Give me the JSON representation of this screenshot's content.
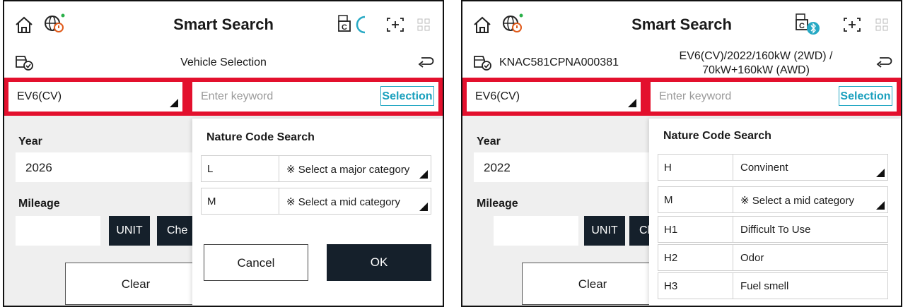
{
  "colors": {
    "accent_red": "#e3102d",
    "dark_button": "#15202b",
    "selection_blue": "#1aa0bd"
  },
  "panels": [
    {
      "title": "Smart Search",
      "subbar": {
        "title": "Vehicle Selection",
        "vin": "",
        "desc": ""
      },
      "model": "EV6(CV)",
      "keyword_placeholder": "Enter keyword",
      "selection_label": "Selection",
      "year_label": "Year",
      "year_value": "2026",
      "mileage_label": "Mileage",
      "unit_label": "UNIT",
      "check_label": "Che",
      "clear_label": "Clear",
      "dialog": {
        "title": "Nature Code Search",
        "rows": [
          {
            "code": "L",
            "text": "※ Select a major category"
          },
          {
            "code": "M",
            "text": "※ Select a mid category"
          }
        ],
        "cancel_label": "Cancel",
        "ok_label": "OK"
      }
    },
    {
      "title": "Smart Search",
      "subbar": {
        "title": "",
        "vin": "KNAC581CPNA000381",
        "desc": "EV6(CV)/2022/160kW (2WD) / 70kW+160kW (AWD)"
      },
      "model": "EV6(CV)",
      "keyword_placeholder": "Enter keyword",
      "selection_label": "Selection",
      "year_label": "Year",
      "year_value": "2022",
      "mileage_label": "Mileage",
      "unit_label": "UNIT",
      "check_label": "Che",
      "clear_label": "Clear",
      "dialog": {
        "title": "Nature Code Search",
        "rows": [
          {
            "code": "H",
            "text": "Convinent"
          },
          {
            "code": "M",
            "text": "※ Select a mid category"
          },
          {
            "code": "H1",
            "text": "Difficult To Use"
          },
          {
            "code": "H2",
            "text": "Odor"
          },
          {
            "code": "H3",
            "text": "Fuel smell"
          }
        ]
      }
    }
  ]
}
